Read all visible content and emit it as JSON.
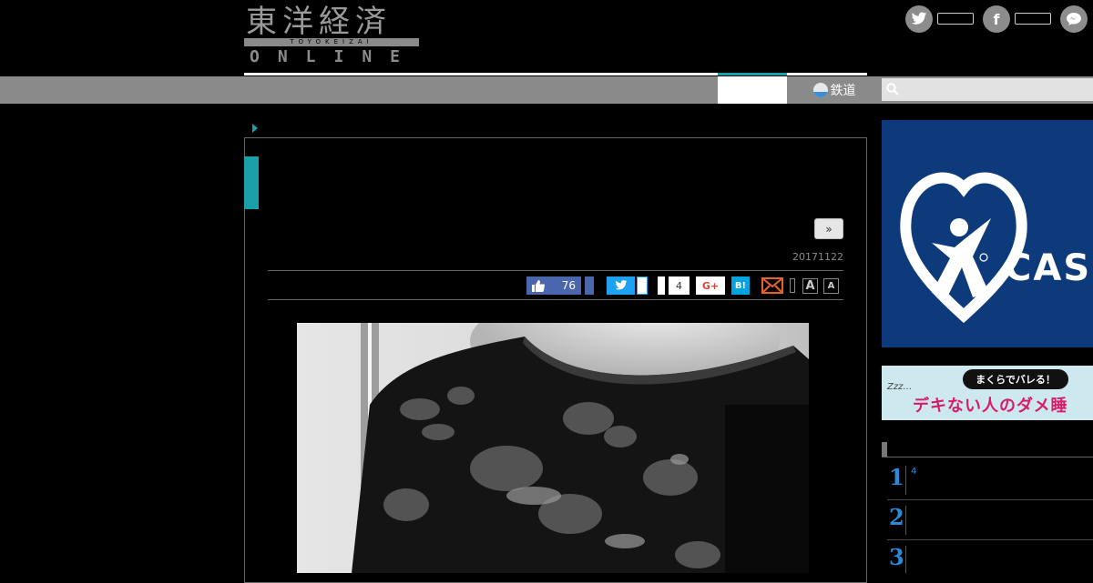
{
  "header": {
    "logo_kanji": "東洋経済",
    "logo_roman": "TOYOKEIZAI",
    "logo_online": "ONLINE",
    "social_icons": [
      "twitter-icon",
      "facebook-icon",
      "chat-icon"
    ]
  },
  "nav": {
    "rail_label": "鉄道",
    "search_placeholder": ""
  },
  "article": {
    "more_label": "»",
    "date": "20171122",
    "share": {
      "fb_like_count": "76",
      "g_count": "4",
      "gplus_label": "G+",
      "hatena_label": "B!",
      "font_large": "A",
      "font_small": "A"
    }
  },
  "sidebar": {
    "ad1_text": "CAS",
    "ad2_pill": "まくらでバレる！",
    "ad2_zz": "Zzz…",
    "ad2_main": "デキない人のダメ睡",
    "ranking": [
      {
        "num": "1",
        "sup": "4"
      },
      {
        "num": "2",
        "sup": ""
      },
      {
        "num": "3",
        "sup": ""
      }
    ]
  },
  "colors": {
    "accent": "#1aa0a8",
    "rank": "#2a8ad9",
    "fb": "#4a67ad",
    "twitter": "#1da1f2"
  }
}
